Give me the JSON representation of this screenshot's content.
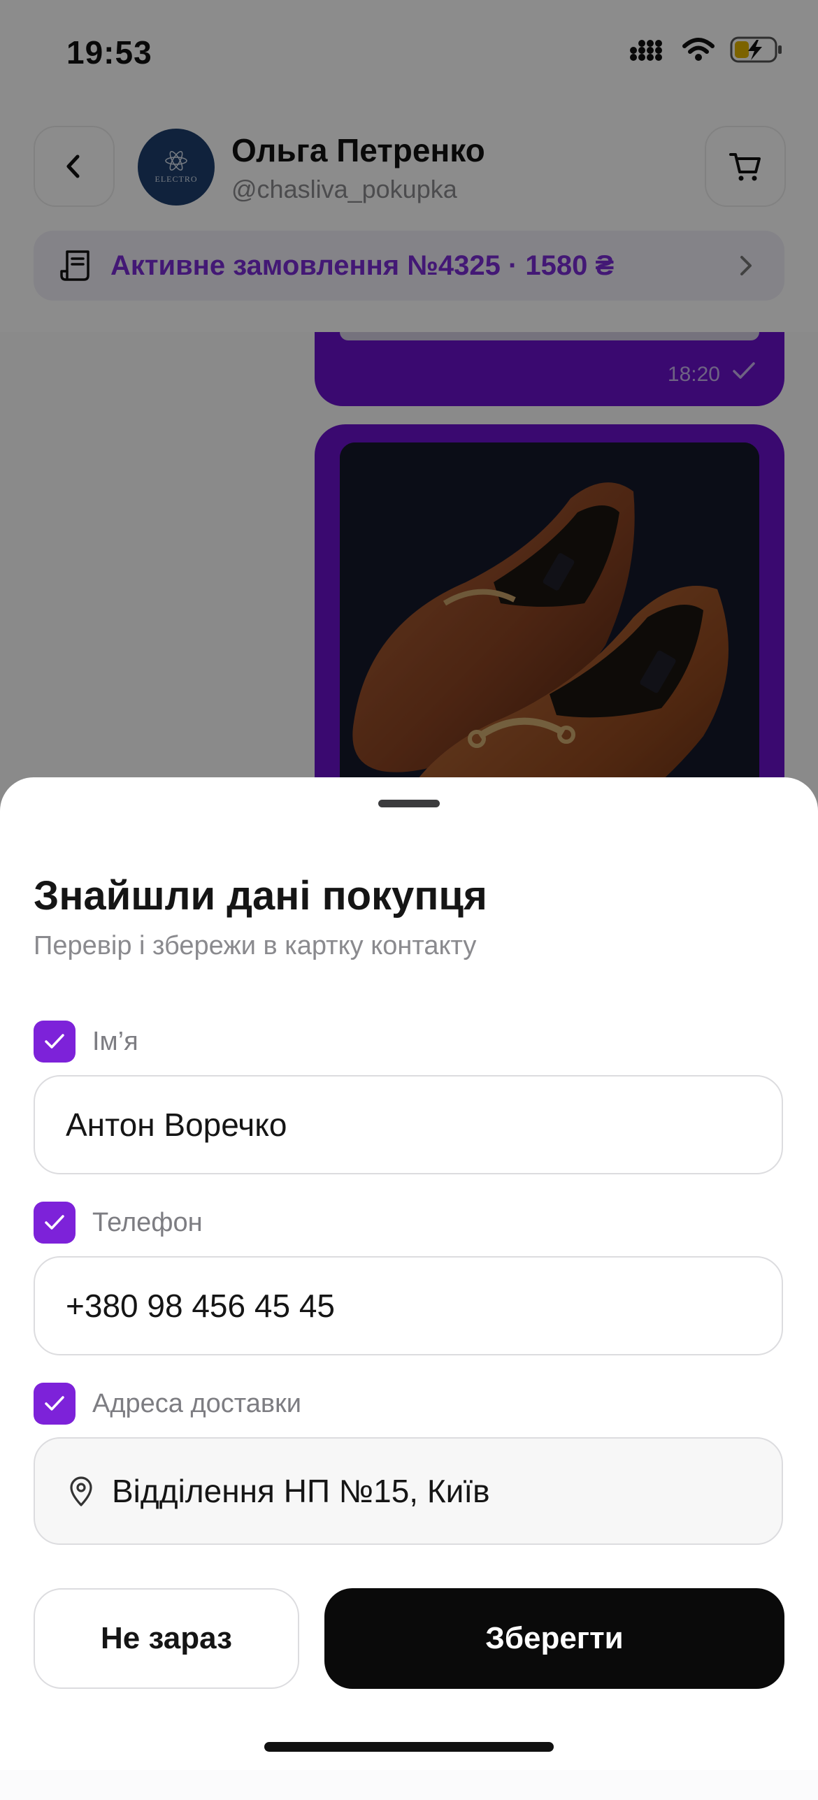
{
  "status_bar": {
    "time": "19:53"
  },
  "header": {
    "contact_name": "Ольга Петренко",
    "contact_handle": "@chasliva_pokupka",
    "avatar_text": "ELECTRO"
  },
  "order_banner": {
    "text": "Активне замовлення №4325 · 1580 ₴"
  },
  "chat": {
    "message_time": "18:20"
  },
  "sheet": {
    "title": "Знайшли дані покупця",
    "subtitle": "Перевір і збережи в картку контакту",
    "fields": [
      {
        "label": "Ім’я",
        "value": "Антон Воречко",
        "checked": true
      },
      {
        "label": "Телефон",
        "value": "+380 98 456 45 45",
        "checked": true
      },
      {
        "label": "Адреса доставки",
        "value": "Відділення НП №15, Київ",
        "checked": true
      }
    ],
    "cancel_label": "Не зараз",
    "save_label": "Зберегти"
  },
  "colors": {
    "accent": "#7d22d9",
    "bubble": "#6a12cc",
    "primary_button": "#0a0a0a"
  }
}
